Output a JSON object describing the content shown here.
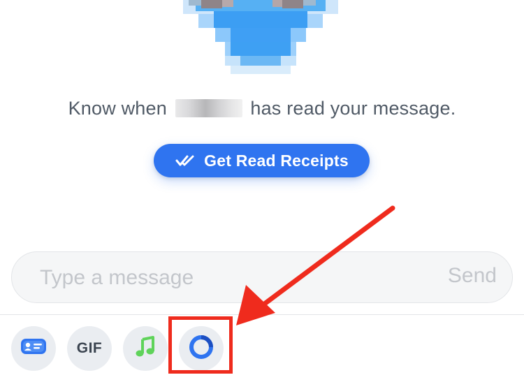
{
  "read_receipts": {
    "prefix": "Know when",
    "suffix": "has read your message.",
    "button_label": "Get Read Receipts"
  },
  "composer": {
    "placeholder": "Type a message",
    "send_label": "Send"
  },
  "toolbar": {
    "gif_label": "GIF",
    "items": [
      {
        "icon": "contact-card-icon"
      },
      {
        "icon": "gif-icon"
      },
      {
        "icon": "music-note-icon"
      },
      {
        "icon": "loop-icon"
      }
    ]
  },
  "colors": {
    "accent": "#2f74f0",
    "annotation": "#ef2b1d",
    "music": "#5fd35a"
  }
}
